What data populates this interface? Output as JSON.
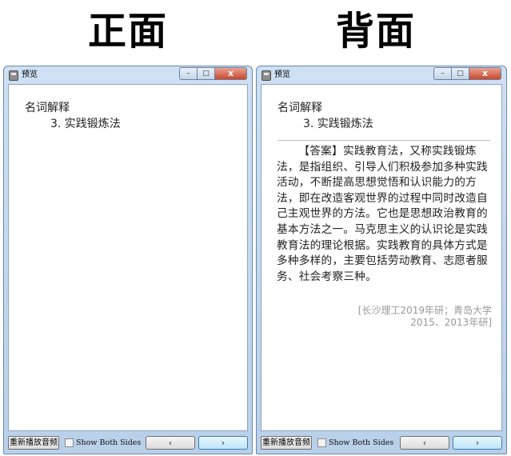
{
  "headings": {
    "front": "正面",
    "back": "背面"
  },
  "front_window": {
    "title": "预览",
    "card": {
      "question_title": "名词解释",
      "question_item": "3. 实践锻炼法"
    },
    "bottom": {
      "replay_label": "重新播放音频",
      "show_both_label": "Show Both Sides",
      "show_both_checked": false,
      "prev_label": "‹",
      "next_label": "›"
    }
  },
  "back_window": {
    "title": "预览",
    "card": {
      "question_title": "名词解释",
      "question_item": "3. 实践锻炼法",
      "answer": "【答案】实践教育法，又称实践锻炼法，是指组织、引导人们积极参加多种实践活动，不断提高思想觉悟和认识能力的方法，即在改造客观世界的过程中同时改造自己主观世界的方法。它也是思想政治教育的基本方法之一。马克思主义的认识论是实践教育法的理论根据。实践教育的具体方式是多种多样的，主要包括劳动教育、志愿者服务、社会考察三种。",
      "source_line1": "[长沙理工2019年研；青岛大学",
      "source_line2": "2015、2013年研]"
    },
    "bottom": {
      "replay_label": "重新播放音频",
      "show_both_label": "Show Both Sides",
      "show_both_checked": false,
      "prev_label": "‹",
      "next_label": "›"
    }
  },
  "window_controls": {
    "minimize": "–",
    "maximize": "□",
    "close": "x"
  },
  "icons": {
    "app": "app-icon",
    "minimize": "minimize-icon",
    "maximize": "maximize-icon",
    "close": "close-icon"
  }
}
